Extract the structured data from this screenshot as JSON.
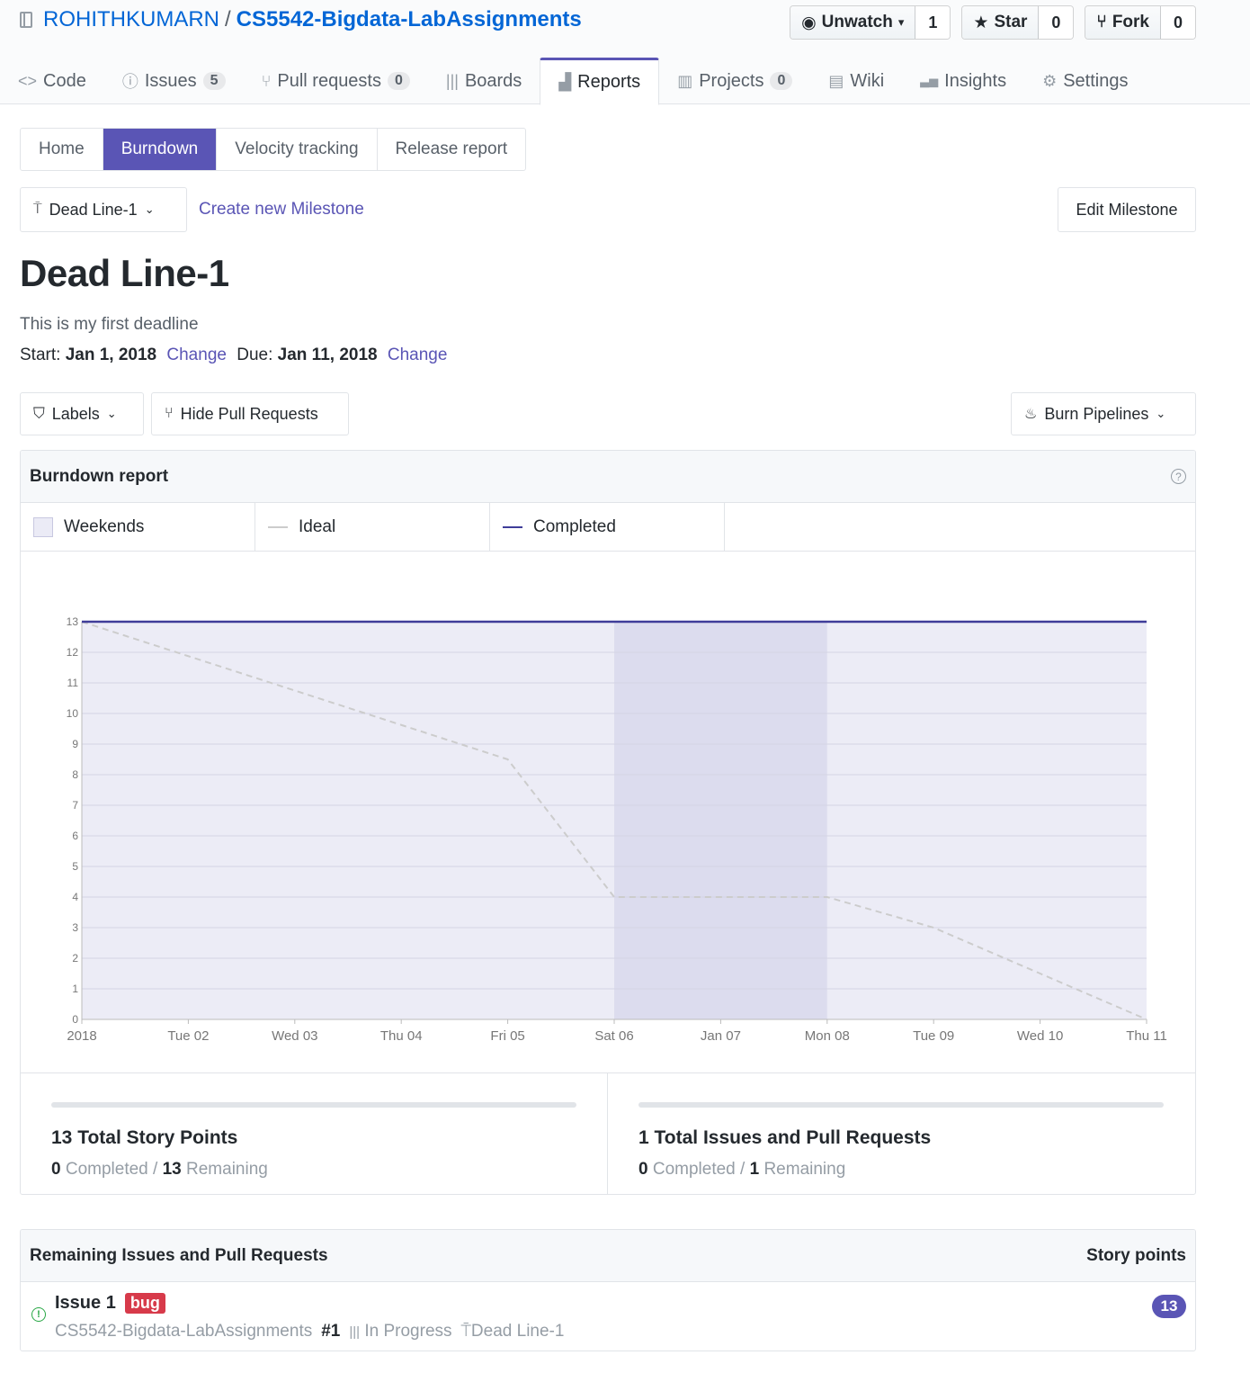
{
  "repo": {
    "owner": "ROHITHKUMARN",
    "separator": "/",
    "name": "CS5542-Bigdata-LabAssignments"
  },
  "actions": [
    {
      "label": "Unwatch",
      "count": "1",
      "icon": "eye-icon",
      "caret": "▾"
    },
    {
      "label": "Star",
      "count": "0",
      "icon": "star-icon"
    },
    {
      "label": "Fork",
      "count": "0",
      "icon": "fork-icon"
    }
  ],
  "reponav": [
    {
      "label": "Code",
      "icon": "code-icon",
      "glyph": "<>"
    },
    {
      "label": "Issues",
      "icon": "issue-icon",
      "glyph": "ⓘ",
      "count": "5"
    },
    {
      "label": "Pull requests",
      "icon": "pull-request-icon",
      "glyph": "⑂",
      "count": "0"
    },
    {
      "label": "Boards",
      "icon": "boards-icon",
      "glyph": "|||"
    },
    {
      "label": "Reports",
      "icon": "reports-icon",
      "glyph": "▟",
      "selected": true
    },
    {
      "label": "Projects",
      "icon": "projects-icon",
      "glyph": "▥",
      "count": "0"
    },
    {
      "label": "Wiki",
      "icon": "wiki-icon",
      "glyph": "▤"
    },
    {
      "label": "Insights",
      "icon": "insights-icon",
      "glyph": "▃▅"
    },
    {
      "label": "Settings",
      "icon": "gear-icon",
      "glyph": "⚙"
    }
  ],
  "subnav": [
    "Home",
    "Burndown",
    "Velocity tracking",
    "Release report"
  ],
  "subnav_active": "Burndown",
  "milestone": {
    "selector": "Dead Line-1",
    "create_link": "Create new Milestone",
    "edit_button": "Edit Milestone",
    "title": "Dead Line-1",
    "description": "This is my first deadline",
    "start_label": "Start:",
    "start": "Jan 1, 2018",
    "due_label": "Due:",
    "due": "Jan 11, 2018",
    "change": "Change"
  },
  "filters": {
    "labels": "Labels",
    "hide_prs": "Hide Pull Requests",
    "burn": "Burn Pipelines"
  },
  "burndown": {
    "title": "Burndown report",
    "legend": [
      {
        "label": "Weekends",
        "kind": "box"
      },
      {
        "label": "Ideal",
        "kind": "line",
        "color": "#cccccc"
      },
      {
        "label": "Completed",
        "kind": "line",
        "color": "#3f3d99"
      }
    ]
  },
  "chart_data": {
    "type": "line",
    "categories": [
      "2018",
      "Tue 02",
      "Wed 03",
      "Thu 04",
      "Fri 05",
      "Sat 06",
      "Jan 07",
      "Mon 08",
      "Tue 09",
      "Wed 10",
      "Thu 11"
    ],
    "ylim": [
      0,
      13
    ],
    "yticks": [
      0,
      1,
      2,
      3,
      4,
      5,
      6,
      7,
      8,
      9,
      10,
      11,
      12,
      13
    ],
    "weekend_range": [
      "Sat 06",
      "Mon 08"
    ],
    "series": [
      {
        "name": "Ideal",
        "color": "#cccccc",
        "dashed": true,
        "values": [
          13,
          11.875,
          10.75,
          9.625,
          8.5,
          4,
          4,
          4,
          3,
          1.5,
          0
        ]
      },
      {
        "name": "Completed",
        "color": "#3f3d99",
        "values": [
          13,
          13,
          13,
          13,
          13,
          13,
          13,
          13,
          13,
          13,
          13
        ]
      }
    ],
    "grid": true
  },
  "stats": [
    {
      "headline": "13 Total Story Points",
      "completed": "0",
      "completed_label": "Completed",
      "sep": "/",
      "remaining": "13",
      "remaining_label": "Remaining",
      "progress": 0
    },
    {
      "headline": "1 Total Issues and Pull Requests",
      "completed": "0",
      "completed_label": "Completed",
      "sep": "/",
      "remaining": "1",
      "remaining_label": "Remaining",
      "progress": 0
    }
  ],
  "remaining": {
    "title": "Remaining Issues and Pull Requests",
    "points_header": "Story points",
    "issues": [
      {
        "title": "Issue 1",
        "label": "bug",
        "repo": "CS5542-Bigdata-LabAssignments",
        "number": "#1",
        "pipeline": "In Progress",
        "milestone": "Dead Line-1",
        "points": "13"
      }
    ]
  }
}
